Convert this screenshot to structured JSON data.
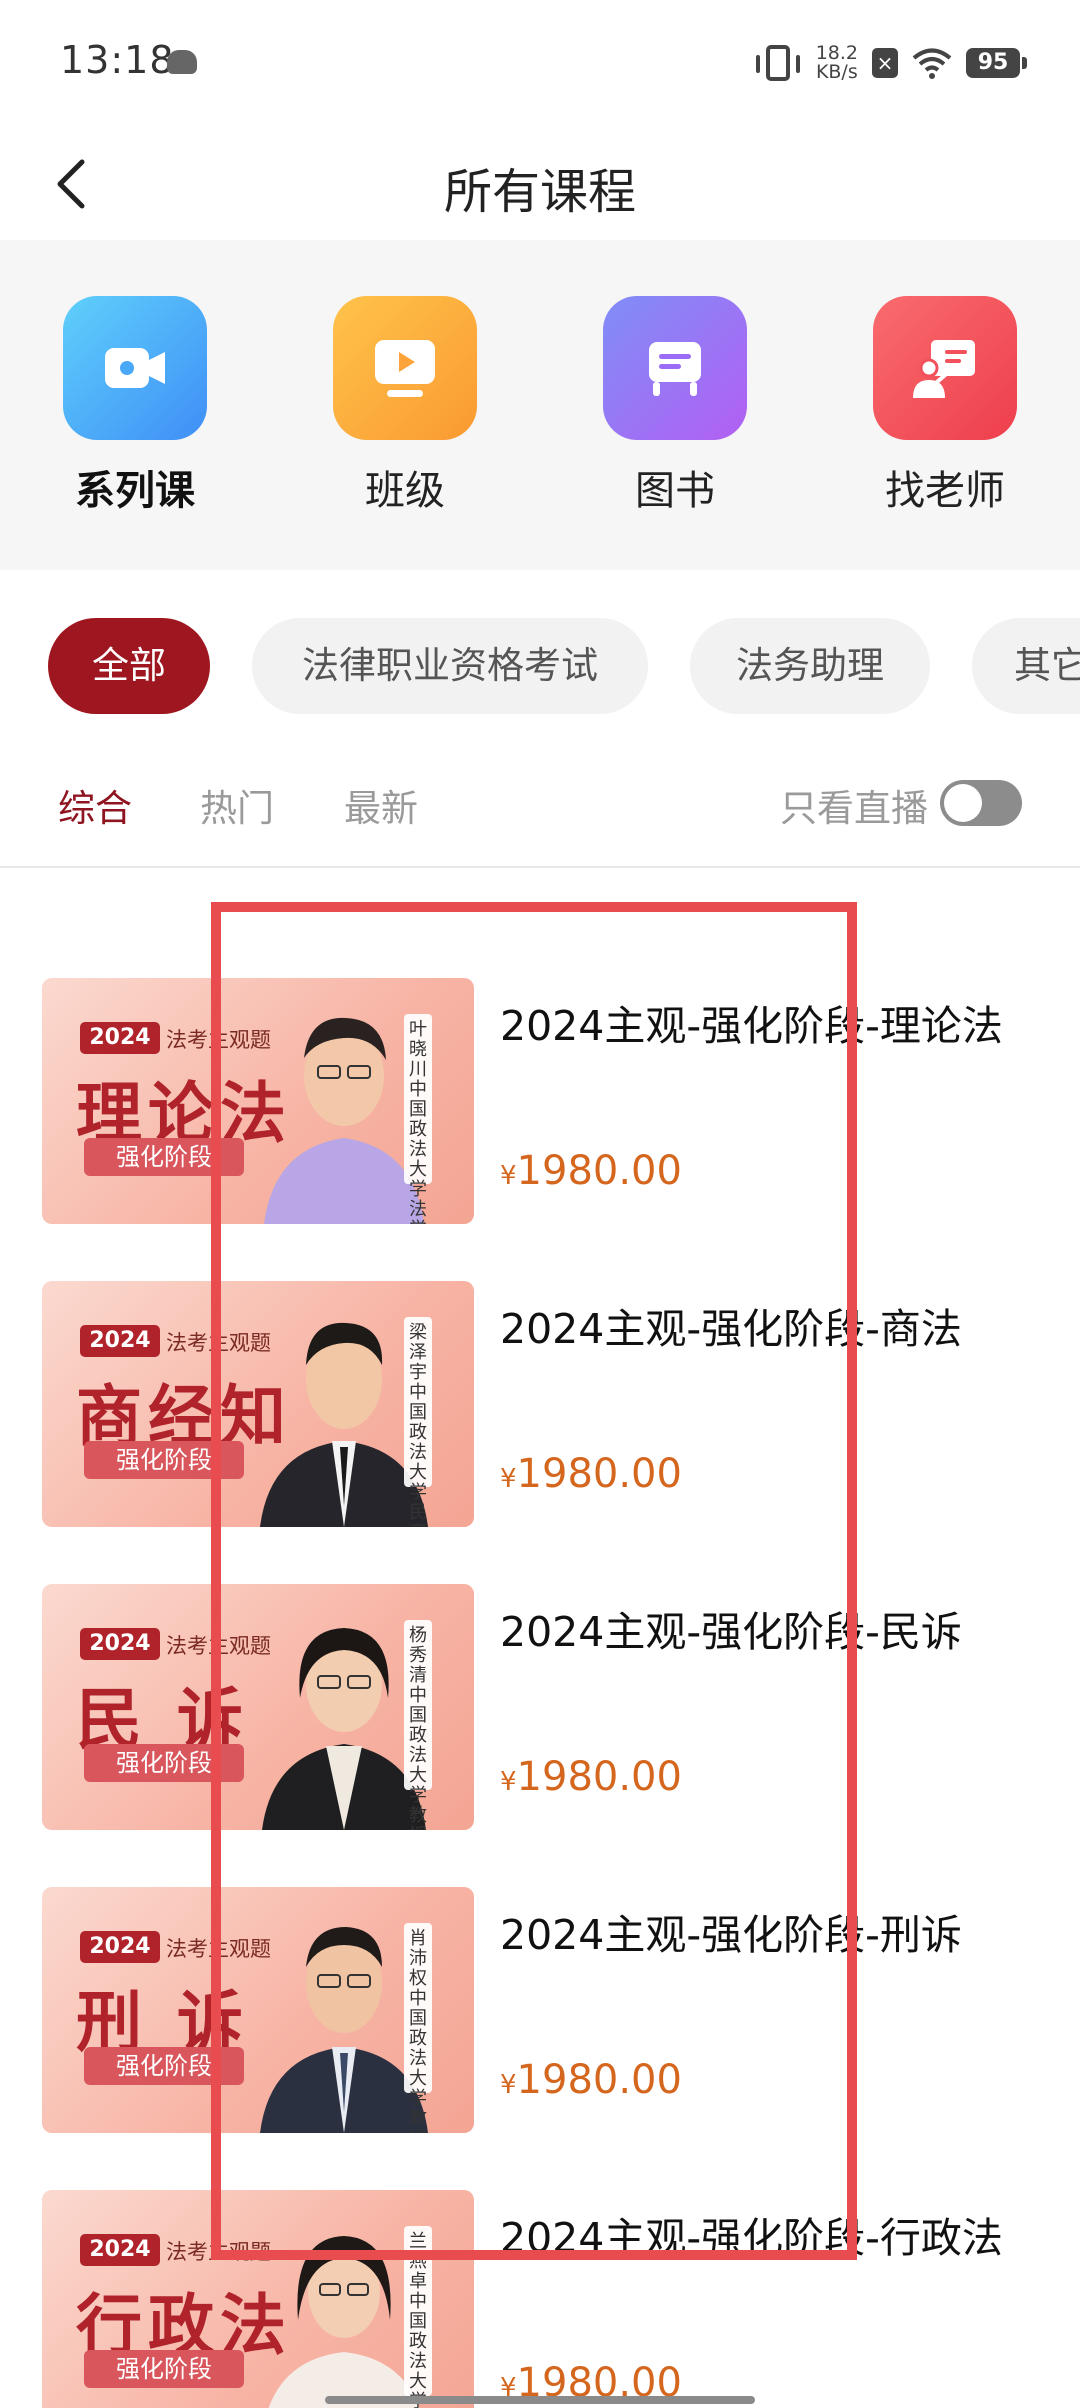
{
  "status_bar": {
    "time": "13:18",
    "net_speed_value": "18.2",
    "net_speed_unit": "KB/s",
    "battery": "95"
  },
  "nav": {
    "title": "所有课程"
  },
  "categories": [
    {
      "label": "系列课",
      "icon": "video-camera-icon",
      "color": "#3fa3f7",
      "active": true
    },
    {
      "label": "班级",
      "icon": "monitor-play-icon",
      "color": "#fba13a",
      "active": false
    },
    {
      "label": "图书",
      "icon": "book-icon",
      "color": "#9b6cf5",
      "active": false
    },
    {
      "label": "找老师",
      "icon": "teacher-icon",
      "color": "#f2505a",
      "active": false
    }
  ],
  "filters": [
    "全部",
    "法律职业资格考试",
    "法务助理",
    "其它"
  ],
  "sort_tabs": [
    "综合",
    "热门",
    "最新"
  ],
  "live_only_label": "只看直播",
  "courses": [
    {
      "title": "2024主观-强化阶段-理论法",
      "price_symbol": "¥",
      "price": "1980.00",
      "thumb_year": "2024",
      "thumb_tag": "法考主观题",
      "thumb_subject": "理论法",
      "thumb_stage": "强化阶段",
      "teacher_caption": "叶晓川 中国政法大学法学博士"
    },
    {
      "title": "2024主观-强化阶段-商法",
      "price_symbol": "¥",
      "price": "1980.00",
      "thumb_year": "2024",
      "thumb_tag": "法考主观题",
      "thumb_subject": "商经知",
      "thumb_stage": "强化阶段",
      "teacher_caption": "梁泽宇 中国政法大学民商经济法学院讲师"
    },
    {
      "title": "2024主观-强化阶段-民诉",
      "price_symbol": "¥",
      "price": "1980.00",
      "thumb_year": "2024",
      "thumb_tag": "法考主观题",
      "thumb_subject": "民 诉",
      "thumb_stage": "强化阶段",
      "teacher_caption": "杨秀清 中国政法大学教授"
    },
    {
      "title": "2024主观-强化阶段-刑诉",
      "price_symbol": "¥",
      "price": "1980.00",
      "thumb_year": "2024",
      "thumb_tag": "法考主观题",
      "thumb_subject": "刑 诉",
      "thumb_stage": "强化阶段",
      "teacher_caption": "肖沛权 中国政法大学教授"
    },
    {
      "title": "2024主观-强化阶段-行政法",
      "price_symbol": "¥",
      "price": "1980.00",
      "thumb_year": "2024",
      "thumb_tag": "法考主观题",
      "thumb_subject": "行政法",
      "thumb_stage": "强化阶段",
      "teacher_caption": "兰燕卓 中国政法大学法学博士"
    }
  ],
  "colors": {
    "accent": "#9e1720",
    "active_tab": "#8e1420",
    "price": "#d4661d",
    "highlight": "#e84c4f"
  }
}
